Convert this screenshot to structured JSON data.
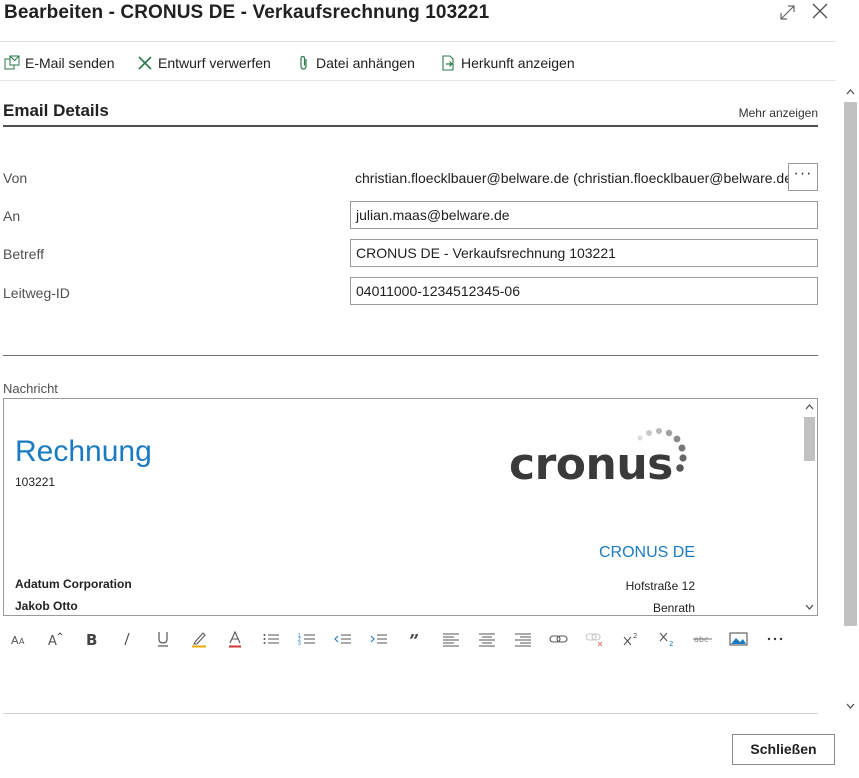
{
  "window": {
    "title": "Bearbeiten - CRONUS DE - Verkaufsrechnung 103221",
    "expand_icon": "expand-icon",
    "close_icon": "close-icon"
  },
  "toolbar": {
    "send_email": "E-Mail senden",
    "discard_draft": "Entwurf verwerfen",
    "attach_file": "Datei anhängen",
    "show_source": "Herkunft anzeigen"
  },
  "section": {
    "title": "Email Details",
    "more_link": "Mehr anzeigen"
  },
  "fields": {
    "from": {
      "label": "Von",
      "value": "christian.floecklbauer@belware.de (christian.floecklbauer@belware.de)",
      "button": "···"
    },
    "to": {
      "label": "An",
      "value": "julian.maas@belware.de"
    },
    "subject": {
      "label": "Betreff",
      "value": "CRONUS DE - Verkaufsrechnung 103221"
    },
    "routing_id": {
      "label": "Leitweg-ID",
      "value": "04011000-1234512345-06"
    }
  },
  "message": {
    "label": "Nachricht",
    "doc_heading": "Rechnung",
    "doc_number": "103221",
    "logo_text": "cronus",
    "company_name": "CRONUS DE",
    "street": "Hofstraße 12",
    "city": "Benrath",
    "customer_name": "Adatum Corporation",
    "contact_name": "Jakob Otto"
  },
  "footer": {
    "close_button": "Schließen"
  },
  "colors": {
    "accent_blue": "#1b7bc2",
    "toolbar_icon": "#2a7a4b",
    "text": "#212121"
  }
}
